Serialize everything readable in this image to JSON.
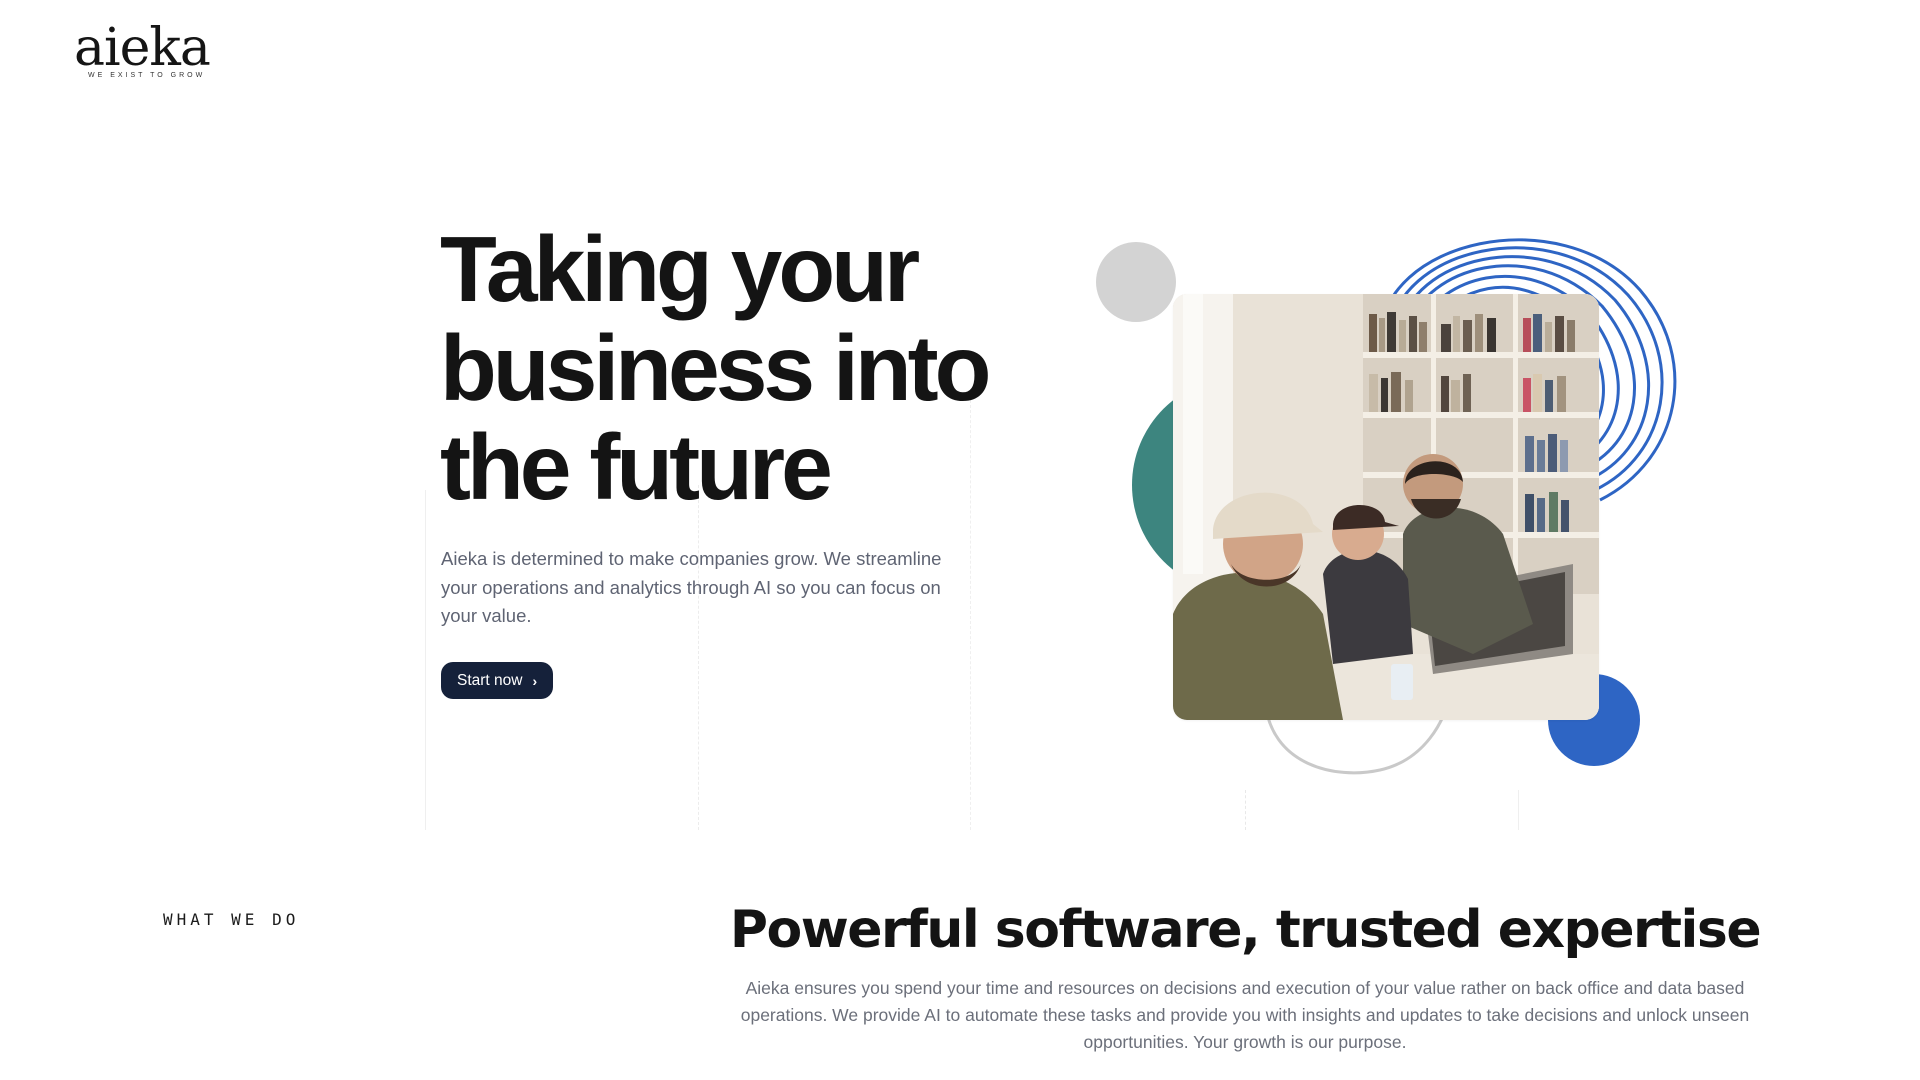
{
  "brand": {
    "name": "aieka",
    "tagline": "we exist to grow"
  },
  "hero": {
    "title": "Taking your business into the future",
    "subtitle": "Aieka is determined to make companies grow. We streamline your operations and analytics through AI so you can focus on your value.",
    "cta_label": "Start now",
    "cta_icon": "chevron-right-icon"
  },
  "what_we_do": {
    "label": "WHAT WE DO",
    "title": "Powerful software, trusted expertise",
    "body": "Aieka ensures you spend your time and resources on decisions and execution of your value rather on back office and data based operations. We provide AI to automate these tasks and provide you with insights and updates to take decisions and unlock unseen opportunities. Your growth is our purpose."
  },
  "colors": {
    "cta_bg": "#15213a",
    "accent_blue": "#2e65c4",
    "accent_teal": "#3d857f",
    "neutral_circle": "#d3d3d3",
    "body_text": "#5f6473"
  }
}
